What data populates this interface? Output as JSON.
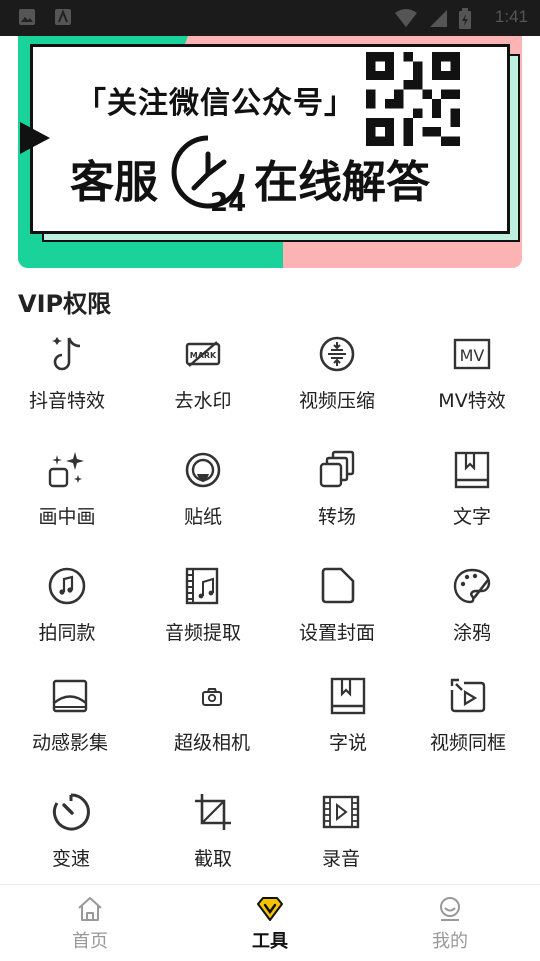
{
  "status_bar": {
    "time": "1:41"
  },
  "banner": {
    "line1": "「关注微信公众号」",
    "line2": "客服",
    "line3": "在线解答",
    "clock_label": "24"
  },
  "section": {
    "title": "VIP权限"
  },
  "tools": [
    {
      "label": "抖音特效",
      "icon": "tiktok-icon"
    },
    {
      "label": "去水印",
      "icon": "watermark-icon"
    },
    {
      "label": "视频压缩",
      "icon": "compress-icon"
    },
    {
      "label": "MV特效",
      "icon": "mv-icon"
    },
    {
      "label": "画中画",
      "icon": "sparkle-pip-icon"
    },
    {
      "label": "贴纸",
      "icon": "sticker-icon"
    },
    {
      "label": "转场",
      "icon": "transition-icon"
    },
    {
      "label": "文字",
      "icon": "text-book-icon"
    },
    {
      "label": "拍同款",
      "icon": "music-disc-icon"
    },
    {
      "label": "音频提取",
      "icon": "audio-extract-icon"
    },
    {
      "label": "设置封面",
      "icon": "cover-icon"
    },
    {
      "label": "涂鸦",
      "icon": "palette-icon"
    },
    {
      "label": "动感影集",
      "icon": "album-icon"
    },
    {
      "label": "超级相机",
      "icon": "camera-icon"
    },
    {
      "label": "字说",
      "icon": "word-book-icon"
    },
    {
      "label": "视频同框",
      "icon": "sync-frame-icon"
    },
    {
      "label": "变速",
      "icon": "speed-icon"
    },
    {
      "label": "截取",
      "icon": "crop-icon"
    },
    {
      "label": "录音",
      "icon": "record-film-icon"
    }
  ],
  "tabbar": {
    "items": [
      {
        "label": "首页",
        "icon": "home-icon"
      },
      {
        "label": "工具",
        "icon": "vip-diamond-icon",
        "active": true
      },
      {
        "label": "我的",
        "icon": "profile-icon"
      }
    ]
  },
  "colors": {
    "accent": "#f5c400",
    "banner_pink": "#fcb3b3",
    "banner_green": "#19d39b"
  }
}
